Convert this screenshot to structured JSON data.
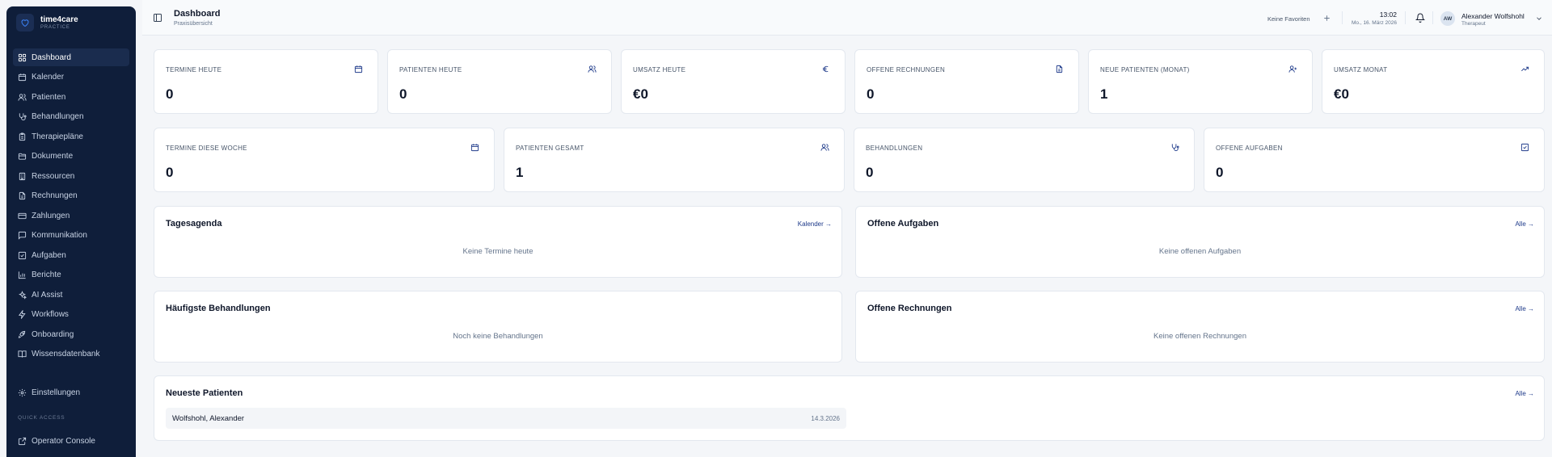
{
  "brand": {
    "name": "time4care",
    "sub": "PRACTICE"
  },
  "nav": {
    "items": [
      {
        "label": "Dashboard",
        "icon": "grid-icon"
      },
      {
        "label": "Kalender",
        "icon": "calendar-icon"
      },
      {
        "label": "Patienten",
        "icon": "users-icon"
      },
      {
        "label": "Behandlungen",
        "icon": "stethoscope-icon"
      },
      {
        "label": "Therapiepläne",
        "icon": "clipboard-icon"
      },
      {
        "label": "Dokumente",
        "icon": "folder-icon"
      },
      {
        "label": "Ressourcen",
        "icon": "building-icon"
      },
      {
        "label": "Rechnungen",
        "icon": "file-text-icon"
      },
      {
        "label": "Zahlungen",
        "icon": "credit-card-icon"
      },
      {
        "label": "Kommunikation",
        "icon": "message-icon"
      },
      {
        "label": "Aufgaben",
        "icon": "check-square-icon"
      },
      {
        "label": "Berichte",
        "icon": "bar-chart-icon"
      },
      {
        "label": "AI Assist",
        "icon": "sparkles-icon"
      },
      {
        "label": "Workflows",
        "icon": "zap-icon"
      },
      {
        "label": "Onboarding",
        "icon": "rocket-icon"
      },
      {
        "label": "Wissensdatenbank",
        "icon": "book-icon"
      }
    ],
    "settings": "Einstellungen",
    "quick_access_label": "QUICK ACCESS",
    "operator_console": "Operator Console"
  },
  "header": {
    "title": "Dashboard",
    "subtitle": "Praxisübersicht",
    "favorites": "Keine Favoriten",
    "time": "13:02",
    "date": "Mo., 16. März 2026",
    "user": {
      "initials": "AW",
      "name": "Alexander Wolfshohl",
      "role": "Therapeut"
    }
  },
  "stats_row1": [
    {
      "label": "TERMINE HEUTE",
      "value": "0",
      "icon": "calendar-icon"
    },
    {
      "label": "PATIENTEN HEUTE",
      "value": "0",
      "icon": "users-icon"
    },
    {
      "label": "UMSATZ HEUTE",
      "value": "€0",
      "icon": "euro-icon"
    },
    {
      "label": "OFFENE RECHNUNGEN",
      "value": "0",
      "icon": "file-text-icon"
    },
    {
      "label": "NEUE PATIENTEN (MONAT)",
      "value": "1",
      "icon": "user-plus-icon"
    },
    {
      "label": "UMSATZ MONAT",
      "value": "€0",
      "icon": "trending-up-icon"
    }
  ],
  "stats_row2": [
    {
      "label": "TERMINE DIESE WOCHE",
      "value": "0",
      "icon": "calendar-icon"
    },
    {
      "label": "PATIENTEN GESAMT",
      "value": "1",
      "icon": "users-icon"
    },
    {
      "label": "BEHANDLUNGEN",
      "value": "0",
      "icon": "stethoscope-icon"
    },
    {
      "label": "OFFENE AUFGABEN",
      "value": "0",
      "icon": "check-square-icon"
    }
  ],
  "panels": {
    "agenda": {
      "title": "Tagesagenda",
      "link": "Kalender →",
      "empty": "Keine Termine heute"
    },
    "tasks": {
      "title": "Offene Aufgaben",
      "link": "Alle →",
      "empty": "Keine offenen Aufgaben"
    },
    "top_treatments": {
      "title": "Häufigste Behandlungen",
      "empty": "Noch keine Behandlungen"
    },
    "open_invoices": {
      "title": "Offene Rechnungen",
      "link": "Alle →",
      "empty": "Keine offenen Rechnungen"
    },
    "newest_patients": {
      "title": "Neueste Patienten",
      "link": "Alle →",
      "rows": [
        {
          "name": "Wolfshohl, Alexander",
          "date": "14.3.2026"
        }
      ]
    }
  },
  "colors": {
    "sidebar_bg": "#0f1e3a",
    "accent": "#1e3a8a",
    "page_bg": "#f4f6f9"
  }
}
